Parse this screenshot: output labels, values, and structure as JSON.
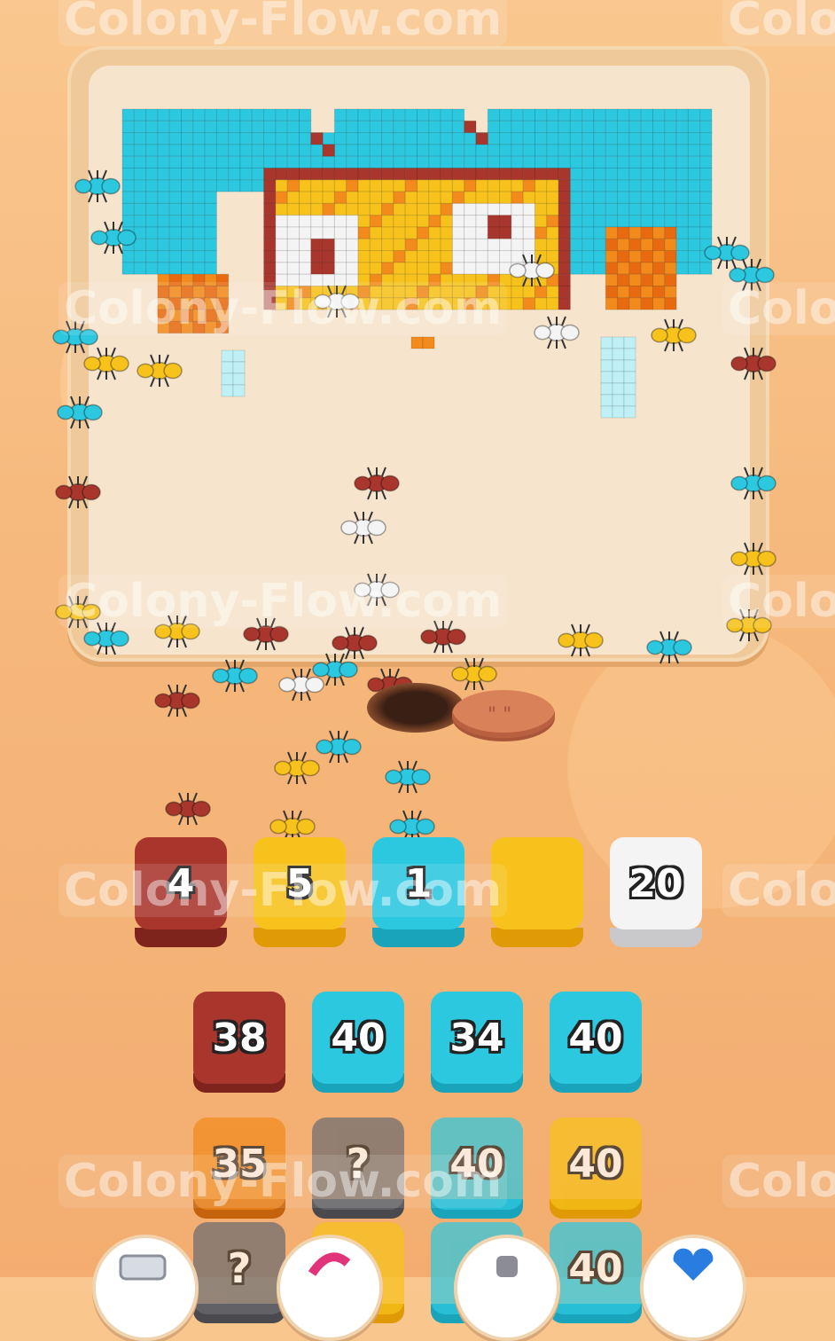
{
  "watermark": "Colony-Flow.com",
  "watermark_partial": "Colo",
  "colors": {
    "red": "#a8362c",
    "orange": "#f28a1c",
    "yellow": "#f7c21b",
    "cyan": "#2cc8e0",
    "white": "#f4f4f4",
    "gray": "#6c6c70"
  },
  "queue": [
    {
      "label": "4",
      "color": "red"
    },
    {
      "label": "5",
      "color": "yellow"
    },
    {
      "label": "1",
      "color": "cyan"
    },
    {
      "label": "",
      "color": "yellow"
    },
    {
      "label": "20",
      "color": "white"
    }
  ],
  "grid_rows": [
    [
      {
        "label": "38",
        "color": "red"
      },
      {
        "label": "40",
        "color": "cyan"
      },
      {
        "label": "34",
        "color": "cyan"
      },
      {
        "label": "40",
        "color": "cyan"
      }
    ],
    [
      {
        "label": "35",
        "color": "orange"
      },
      {
        "label": "?",
        "color": "gray"
      },
      {
        "label": "40",
        "color": "cyan"
      },
      {
        "label": "40",
        "color": "yellow"
      }
    ],
    [
      {
        "label": "?",
        "color": "gray"
      },
      {
        "label": "",
        "color": "yellow"
      },
      {
        "label": "4",
        "color": "cyan"
      },
      {
        "label": "40",
        "color": "cyan"
      }
    ]
  ],
  "bottom_buttons": [
    "eraser-icon",
    "arrow-icon",
    "bell-icon",
    "heart-icon"
  ]
}
